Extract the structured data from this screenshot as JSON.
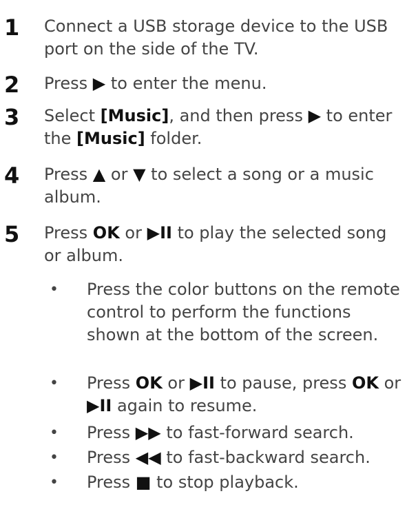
{
  "steps": [
    {
      "n": "1",
      "text": "Connect a USB storage device to the USB port on the side of the TV."
    },
    {
      "n": "2",
      "pre": "Press ",
      "sym": "▶",
      "post": " to enter the menu."
    },
    {
      "n": "3",
      "pre": "Select ",
      "b1": "[Music]",
      "mid": ", and then press ",
      "sym": "▶",
      "mid2": " to enter the ",
      "b2": "[Music]",
      "post": " folder."
    },
    {
      "n": "4",
      "pre": "Press ",
      "sym1": "▲",
      "mid": " or ",
      "sym2": "▼",
      "post": " to select a song or a music album."
    },
    {
      "n": "5",
      "pre": "Press ",
      "b1": "OK",
      "mid": " or ",
      "sym": "▶II",
      "post": " to play the selected song or album."
    }
  ],
  "bullets": [
    {
      "marker": "•",
      "text": "Press the color buttons on the remote control to perform the functions shown at the bottom of the screen."
    },
    {
      "marker": "•",
      "pre": "Press ",
      "b1": "OK",
      "mid": " or ",
      "sym1": "▶II",
      "mid2": " to pause, press ",
      "b2": "OK",
      "mid3": " or ",
      "sym2": "▶II",
      "post": " again to resume."
    },
    {
      "marker": "•",
      "pre": "Press ",
      "sym": "▶▶",
      "post": " to fast-forward search."
    },
    {
      "marker": "•",
      "pre": "Press ",
      "sym": "◀◀",
      "post": " to fast-backward search."
    },
    {
      "marker": "•",
      "pre": "Press ",
      "sym": "■",
      "post": " to stop playback."
    }
  ]
}
